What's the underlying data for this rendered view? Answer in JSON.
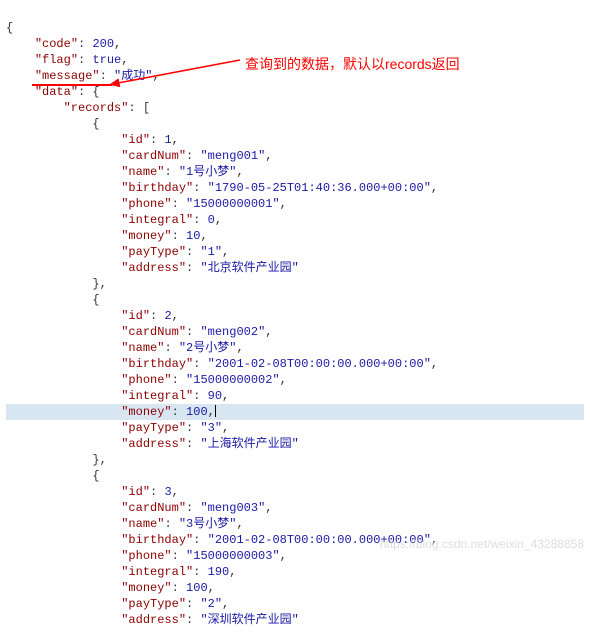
{
  "annotation": "查询到的数据，默认以records返回",
  "watermark": "https://blog.csdn.net/weixin_43288858",
  "json_top": {
    "code": 200,
    "flag": true,
    "message": "成功"
  },
  "records": [
    {
      "id": 1,
      "cardNum": "meng001",
      "name": "1号小梦",
      "birthday": "1790-05-25T01:40:36.000+00:00",
      "phone": "15000000001",
      "integral": 0,
      "money": 10,
      "payType": "1",
      "address": "北京软件产业园"
    },
    {
      "id": 2,
      "cardNum": "meng002",
      "name": "2号小梦",
      "birthday": "2001-02-08T00:00:00.000+00:00",
      "phone": "15000000002",
      "integral": 90,
      "money": 100,
      "payType": "3",
      "address": "上海软件产业园"
    },
    {
      "id": 3,
      "cardNum": "meng003",
      "name": "3号小梦",
      "birthday": "2001-02-08T00:00:00.000+00:00",
      "phone": "15000000003",
      "integral": 190,
      "money": 100,
      "payType": "2",
      "address": "深圳软件产业园"
    }
  ]
}
